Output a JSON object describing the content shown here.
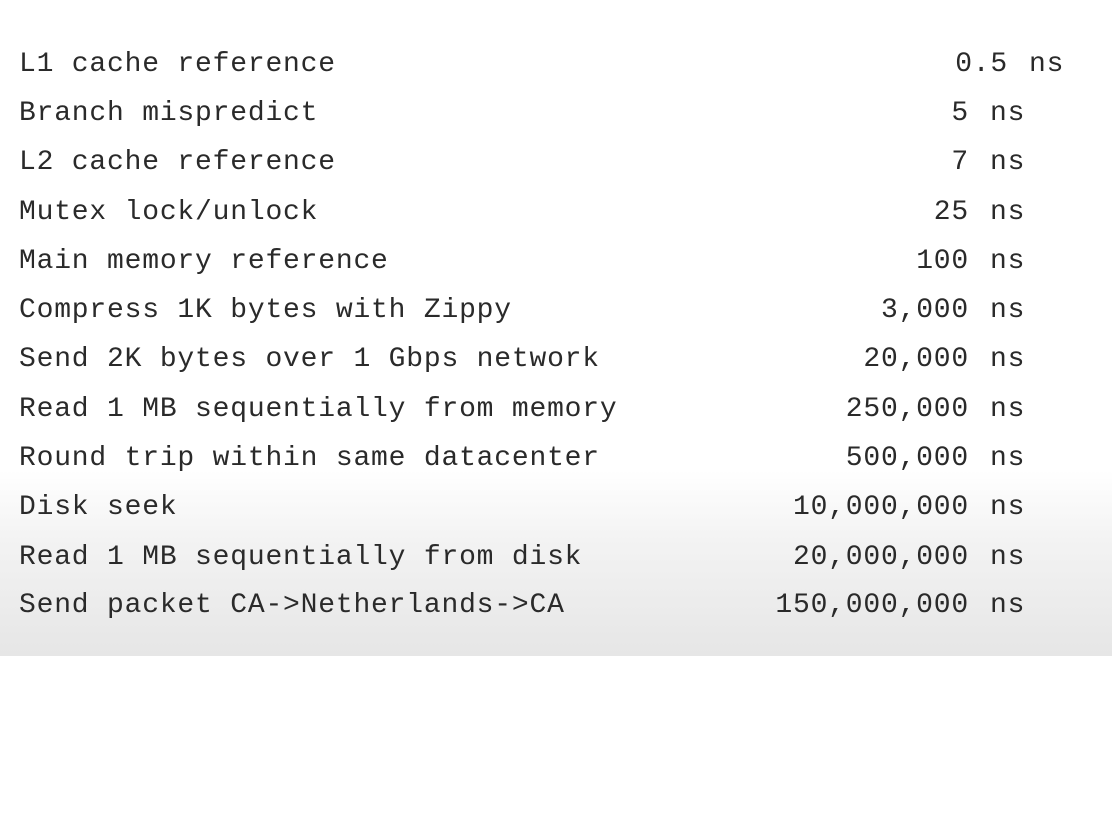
{
  "latencies": [
    {
      "operation": "L1 cache reference",
      "value": "0.5",
      "unit": "ns"
    },
    {
      "operation": "Branch mispredict",
      "value": "5",
      "unit": "ns"
    },
    {
      "operation": "L2 cache reference",
      "value": "7",
      "unit": "ns"
    },
    {
      "operation": "Mutex lock/unlock",
      "value": "25",
      "unit": "ns"
    },
    {
      "operation": "Main memory reference",
      "value": "100",
      "unit": "ns"
    },
    {
      "operation": "Compress 1K bytes with Zippy",
      "value": "3,000",
      "unit": "ns"
    },
    {
      "operation": "Send 2K bytes over 1 Gbps network",
      "value": "20,000",
      "unit": "ns"
    },
    {
      "operation": "Read 1 MB sequentially from memory",
      "value": "250,000",
      "unit": "ns"
    },
    {
      "operation": "Round trip within same datacenter",
      "value": "500,000",
      "unit": "ns"
    },
    {
      "operation": "Disk seek",
      "value": "10,000,000",
      "unit": "ns"
    },
    {
      "operation": "Read 1 MB sequentially from disk",
      "value": "20,000,000",
      "unit": "ns"
    },
    {
      "operation": "Send packet CA->Netherlands->CA",
      "value": "150,000,000",
      "unit": "ns"
    }
  ]
}
